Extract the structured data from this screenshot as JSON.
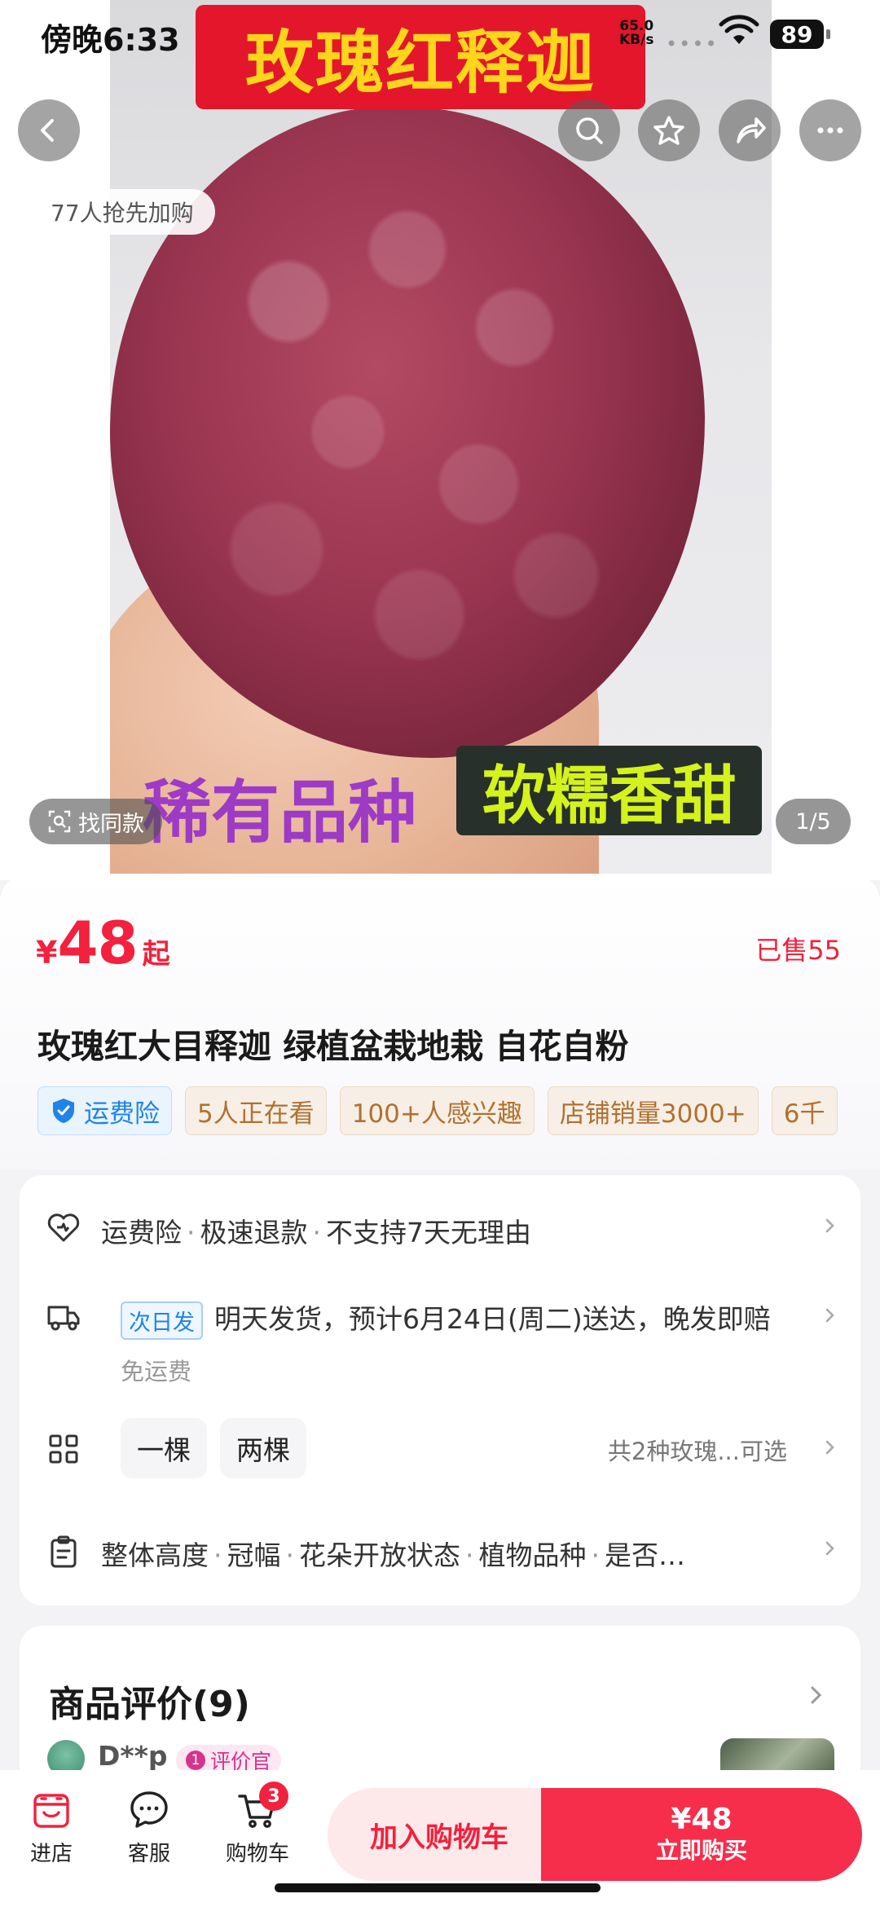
{
  "status_bar": {
    "time": "傍晚6:33",
    "net_speed": "65.0",
    "net_unit": "KB/s",
    "battery": "89"
  },
  "hero": {
    "banner_title": "玫瑰红释迦",
    "overlay_rare": "稀有品种",
    "overlay_taste": "软糯香甜",
    "buyers_text": "77人抢先加购",
    "find_similar": "找同款",
    "image_counter": "1/5"
  },
  "top_actions": {
    "back": "back-icon",
    "search": "search-icon",
    "favorite": "star-icon",
    "share": "share-icon",
    "more": "more-icon"
  },
  "product": {
    "price_symbol": "¥",
    "price": "48",
    "price_suffix": "起",
    "sold": "已售55",
    "title": "玫瑰红大目释迦 绿植盆栽地栽 自花自粉",
    "tags": [
      "运费险",
      "5人正在看",
      "100+人感兴趣",
      "店铺销量3000+",
      "6千"
    ]
  },
  "services": {
    "guarantee": {
      "items": [
        "运费险",
        "极速退款",
        "不支持7天无理由"
      ]
    },
    "shipping": {
      "badge": "次日发",
      "text": "明天发货，预计6月24日(周二)送达，晚发即赔",
      "sub": "免运费"
    },
    "options": {
      "items": [
        "一棵",
        "两棵"
      ],
      "summary": "共2种玫瑰...可选"
    },
    "params": {
      "items": [
        "整体高度",
        "冠幅",
        "花朵开放状态",
        "植物品种",
        "是否…"
      ]
    }
  },
  "reviews": {
    "title": "商品评价(9)",
    "user": "D**p",
    "badge_num": "1",
    "badge_label": "评价官"
  },
  "bottom_bar": {
    "shop": "进店",
    "service": "客服",
    "cart": "购物车",
    "cart_count": "3",
    "add_to_cart": "加入购物车",
    "buy_price": "¥48",
    "buy_now": "立即购买"
  },
  "colors": {
    "accent_red": "#f2213d",
    "blue": "#1f83e8",
    "tag_brown": "#b0712f"
  }
}
